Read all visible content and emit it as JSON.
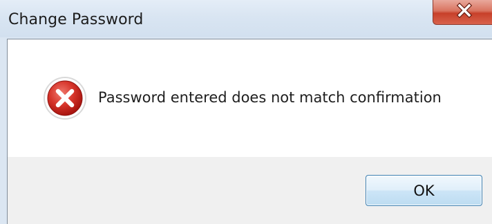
{
  "window": {
    "title": "Change Password",
    "close_icon": "close-x-icon"
  },
  "dialog": {
    "icon": "error-icon",
    "message": "Password entered does not match confirmation",
    "ok_label": "OK"
  },
  "colors": {
    "close_button": "#c7402a",
    "error_icon": "#c8261f",
    "ok_border": "#3c7fb1"
  }
}
